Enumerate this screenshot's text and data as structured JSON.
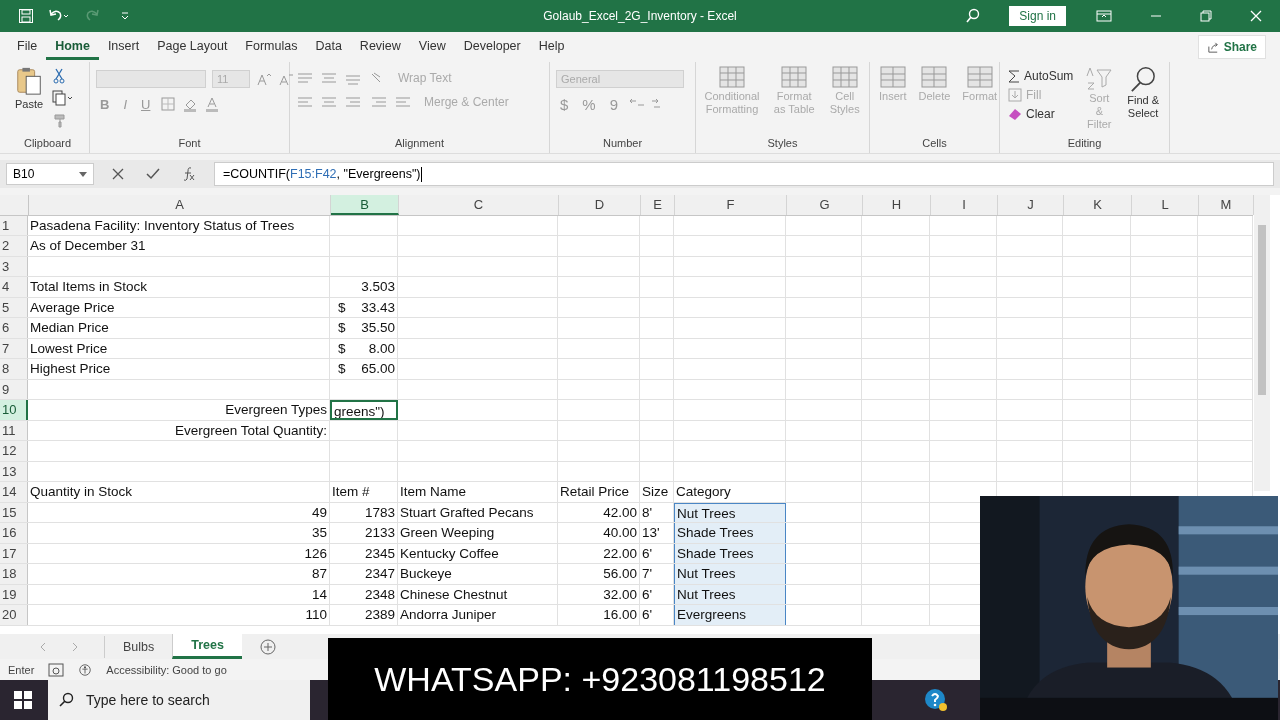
{
  "title_bar": {
    "title": "Golaub_Excel_2G_Inventory  -  Excel",
    "sign_in": "Sign in"
  },
  "menu": [
    {
      "label": "File",
      "selected": false
    },
    {
      "label": "Home",
      "selected": true
    },
    {
      "label": "Insert",
      "selected": false
    },
    {
      "label": "Page Layout",
      "selected": false
    },
    {
      "label": "Formulas",
      "selected": false
    },
    {
      "label": "Data",
      "selected": false
    },
    {
      "label": "Review",
      "selected": false
    },
    {
      "label": "View",
      "selected": false
    },
    {
      "label": "Developer",
      "selected": false
    },
    {
      "label": "Help",
      "selected": false
    }
  ],
  "share": "Share",
  "ribbon": {
    "clipboard": {
      "label": "Clipboard",
      "paste": "Paste"
    },
    "font": {
      "label": "Font",
      "size": "11",
      "bold": "B",
      "italic": "I",
      "underline": "U",
      "disabled": true
    },
    "alignment": {
      "label": "Alignment",
      "wrap": "Wrap Text",
      "merge": "Merge & Center",
      "disabled": true
    },
    "number": {
      "label": "Number",
      "format": "General",
      "currency": "$",
      "percent": "%",
      "comma": "9",
      "disabled": true
    },
    "styles": {
      "label": "Styles",
      "items": [
        {
          "label": "Conditional Formatting",
          "disabled": true
        },
        {
          "label": "Format as Table",
          "disabled": true
        },
        {
          "label": "Cell Styles",
          "disabled": true
        }
      ]
    },
    "cells": {
      "label": "Cells",
      "items": [
        {
          "label": "Insert",
          "disabled": true
        },
        {
          "label": "Delete",
          "disabled": true
        },
        {
          "label": "Format",
          "disabled": true
        }
      ]
    },
    "editing": {
      "label": "Editing",
      "autosum": {
        "label": "AutoSum",
        "disabled": false
      },
      "fill": {
        "label": "Fill",
        "disabled": true
      },
      "clear": {
        "label": "Clear",
        "disabled": false
      },
      "sort": {
        "label": "Sort & Filter",
        "disabled": true
      },
      "find": {
        "label": "Find & Select",
        "disabled": false
      }
    }
  },
  "formula_bar": {
    "name_box": "B10",
    "formula_prefix": "=COUNTIF(",
    "formula_reference": "F15:F42",
    "formula_suffix": ", \"Evergreens\")"
  },
  "columns": [
    {
      "letter": "A",
      "selected": false
    },
    {
      "letter": "B",
      "selected": true
    },
    {
      "letter": "C",
      "selected": false
    },
    {
      "letter": "D",
      "selected": false
    },
    {
      "letter": "E",
      "selected": false
    },
    {
      "letter": "F",
      "selected": false
    },
    {
      "letter": "G",
      "selected": false
    },
    {
      "letter": "H",
      "selected": false
    },
    {
      "letter": "I",
      "selected": false
    },
    {
      "letter": "J",
      "selected": false
    },
    {
      "letter": "K",
      "selected": false
    },
    {
      "letter": "L",
      "selected": false
    },
    {
      "letter": "M",
      "selected": false
    }
  ],
  "rows": [
    {
      "number": "1",
      "selected": false,
      "cells": {
        "A": {
          "kind": "text",
          "text": "Pasadena Facility: Inventory Status of Trees"
        }
      }
    },
    {
      "number": "2",
      "selected": false,
      "cells": {
        "A": {
          "kind": "text",
          "text": "As of December 31"
        }
      }
    },
    {
      "number": "3",
      "selected": false
    },
    {
      "number": "4",
      "selected": false,
      "cells": {
        "A": {
          "kind": "text",
          "text": "Total Items in Stock"
        },
        "B": {
          "kind": "number",
          "text": "3.503"
        }
      }
    },
    {
      "number": "5",
      "selected": false,
      "cells": {
        "A": {
          "kind": "text",
          "text": "Average Price"
        },
        "B": {
          "kind": "money",
          "symbol": "$",
          "text": "33.43"
        }
      }
    },
    {
      "number": "6",
      "selected": false,
      "cells": {
        "A": {
          "kind": "text",
          "text": "Median Price"
        },
        "B": {
          "kind": "money",
          "symbol": "$",
          "text": "35.50"
        }
      }
    },
    {
      "number": "7",
      "selected": false,
      "cells": {
        "A": {
          "kind": "text",
          "text": "Lowest Price"
        },
        "B": {
          "kind": "money",
          "symbol": "$",
          "text": "8.00"
        }
      }
    },
    {
      "number": "8",
      "selected": false,
      "cells": {
        "A": {
          "kind": "text",
          "text": "Highest Price"
        },
        "B": {
          "kind": "money",
          "symbol": "$",
          "text": "65.00"
        }
      }
    },
    {
      "number": "9",
      "selected": false
    },
    {
      "number": "10",
      "selected": true,
      "cells": {
        "A": {
          "kind": "number",
          "text": "Evergreen Types"
        },
        "B": {
          "kind": "editing",
          "text": "greens\")"
        }
      }
    },
    {
      "number": "11",
      "selected": false,
      "cells": {
        "A": {
          "kind": "number",
          "text": "Evergreen Total Quantity:"
        }
      }
    },
    {
      "number": "12",
      "selected": false
    },
    {
      "number": "13",
      "selected": false
    },
    {
      "number": "14",
      "selected": false,
      "cells": {
        "A": {
          "kind": "text",
          "text": "Quantity in Stock"
        },
        "B": {
          "kind": "text",
          "text": "Item #"
        },
        "C": {
          "kind": "text",
          "text": "Item Name"
        },
        "D": {
          "kind": "text",
          "text": "Retail Price"
        },
        "E": {
          "kind": "text",
          "text": "Size"
        },
        "F": {
          "kind": "text",
          "text": "Category"
        }
      }
    },
    {
      "number": "15",
      "selected": false,
      "cells": {
        "A": {
          "kind": "number",
          "text": "49"
        },
        "B": {
          "kind": "number",
          "text": "1783"
        },
        "C": {
          "kind": "text",
          "text": "Stuart Grafted Pecans"
        },
        "D": {
          "kind": "number",
          "text": "42.00"
        },
        "E": {
          "kind": "text",
          "text": "8'"
        },
        "F": {
          "kind": "text",
          "text": "Nut Trees",
          "referenced": true
        }
      }
    },
    {
      "number": "16",
      "selected": false,
      "cells": {
        "A": {
          "kind": "number",
          "text": "35"
        },
        "B": {
          "kind": "number",
          "text": "2133"
        },
        "C": {
          "kind": "text",
          "text": "Green Weeping"
        },
        "D": {
          "kind": "number",
          "text": "40.00"
        },
        "E": {
          "kind": "text",
          "text": "13'"
        },
        "F": {
          "kind": "text",
          "text": "Shade Trees",
          "referenced": true
        }
      }
    },
    {
      "number": "17",
      "selected": false,
      "cells": {
        "A": {
          "kind": "number",
          "text": "126"
        },
        "B": {
          "kind": "number",
          "text": "2345"
        },
        "C": {
          "kind": "text",
          "text": "Kentucky Coffee"
        },
        "D": {
          "kind": "number",
          "text": "22.00"
        },
        "E": {
          "kind": "text",
          "text": "6'"
        },
        "F": {
          "kind": "text",
          "text": "Shade Trees",
          "referenced": true
        }
      }
    },
    {
      "number": "18",
      "selected": false,
      "cells": {
        "A": {
          "kind": "number",
          "text": "87"
        },
        "B": {
          "kind": "number",
          "text": "2347"
        },
        "C": {
          "kind": "text",
          "text": "Buckeye"
        },
        "D": {
          "kind": "number",
          "text": "56.00"
        },
        "E": {
          "kind": "text",
          "text": "7'"
        },
        "F": {
          "kind": "text",
          "text": "Nut Trees",
          "referenced": true
        }
      }
    },
    {
      "number": "19",
      "selected": false,
      "cells": {
        "A": {
          "kind": "number",
          "text": "14"
        },
        "B": {
          "kind": "number",
          "text": "2348"
        },
        "C": {
          "kind": "text",
          "text": "Chinese Chestnut"
        },
        "D": {
          "kind": "number",
          "text": "32.00"
        },
        "E": {
          "kind": "text",
          "text": "6'"
        },
        "F": {
          "kind": "text",
          "text": "Nut Trees",
          "referenced": true
        }
      }
    },
    {
      "number": "20",
      "selected": false,
      "cells": {
        "A": {
          "kind": "number",
          "text": "110"
        },
        "B": {
          "kind": "number",
          "text": "2389"
        },
        "C": {
          "kind": "text",
          "text": "Andorra Juniper"
        },
        "D": {
          "kind": "number",
          "text": "16.00"
        },
        "E": {
          "kind": "text",
          "text": "6'"
        },
        "F": {
          "kind": "text",
          "text": "Evergreens",
          "referenced": true
        }
      }
    }
  ],
  "sheet_tabs": [
    {
      "label": "Bulbs",
      "selected": false
    },
    {
      "label": "Trees",
      "selected": true
    }
  ],
  "status_bar": {
    "mode": "Enter",
    "accessibility": "Accessibility: Good to go"
  },
  "taskbar": {
    "search": "Type here to search"
  },
  "banner": {
    "text": "WHATSAPP: +923081198512"
  }
}
